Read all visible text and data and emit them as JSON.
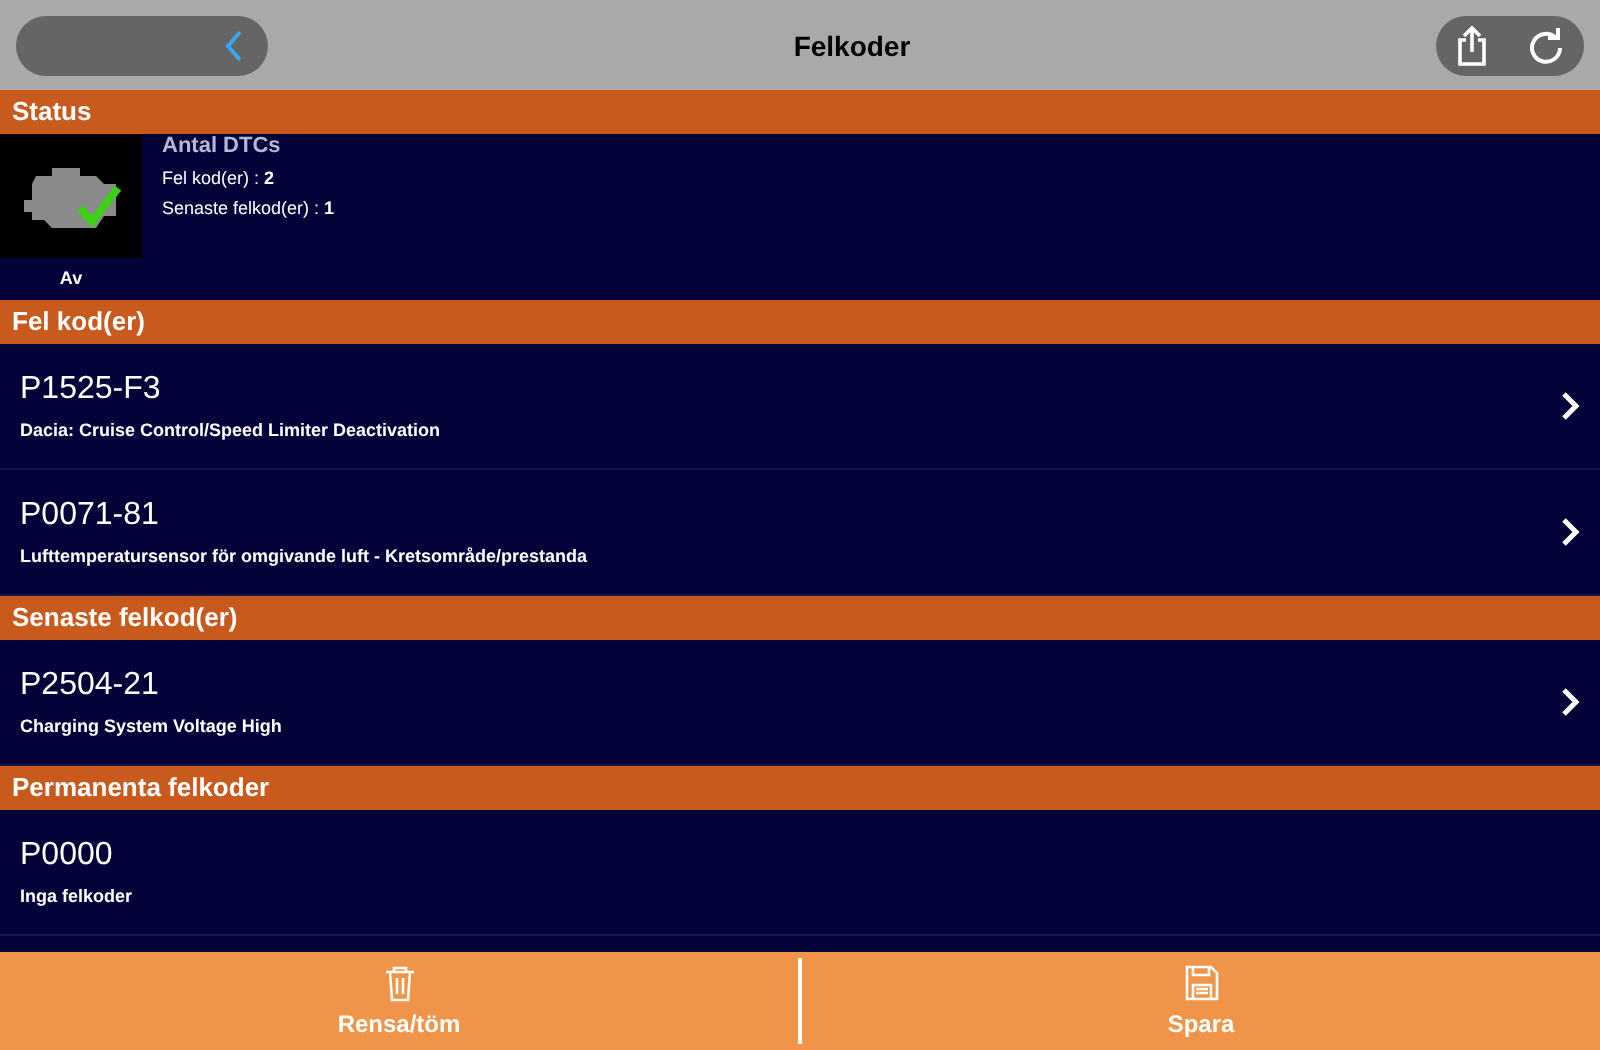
{
  "header": {
    "title": "Felkoder"
  },
  "sections": [
    {
      "kind": "status",
      "title": "Status",
      "engine_label": "Av",
      "heading": "Antal DTCs",
      "lines": [
        "Fel kod(er) : **2**",
        "Senaste felkod(er) : **1**"
      ]
    },
    {
      "kind": "codes",
      "title": "Fel kod(er)",
      "items": [
        {
          "code": "P1525-F3",
          "description": "Dacia: Cruise Control/Speed Limiter Deactivation",
          "has_detail": true
        },
        {
          "code": "P0071-81",
          "description": "Lufttemperatursensor för omgivande luft - Kretsområde/prestanda",
          "has_detail": true
        }
      ]
    },
    {
      "kind": "codes",
      "title": "Senaste felkod(er)",
      "items": [
        {
          "code": "P2504-21",
          "description": "Charging System Voltage High",
          "has_detail": true
        }
      ]
    },
    {
      "kind": "codes",
      "title": "Permanenta felkoder",
      "items": [
        {
          "code": "P0000",
          "description": "Inga felkoder",
          "has_detail": false
        }
      ]
    }
  ],
  "footer": [
    {
      "kind": "trash",
      "label": "Rensa/töm"
    },
    {
      "kind": "save",
      "label": "Spara"
    }
  ]
}
